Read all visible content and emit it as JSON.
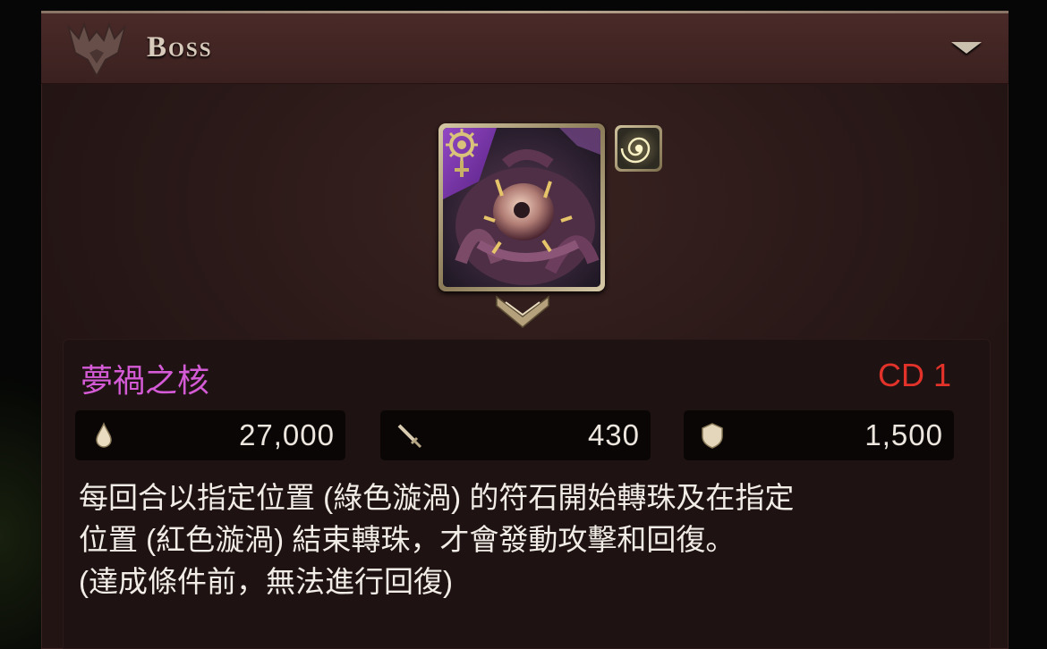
{
  "header": {
    "title": "Boss",
    "emblem_icon": "dragon-head-icon",
    "collapse_icon": "chevron-down-icon"
  },
  "boss": {
    "name": "夢禍之核",
    "cd_label": "CD 1",
    "attribute_icon": "sun-emblem-icon",
    "type_icon": "vortex-icon",
    "name_color": "#d45ad6",
    "cd_color": "#e3322a"
  },
  "stats": {
    "hp": {
      "icon": "hp-drop-icon",
      "value": "27,000"
    },
    "atk": {
      "icon": "sword-icon",
      "value": "430"
    },
    "def": {
      "icon": "shield-icon",
      "value": "1,500"
    }
  },
  "skill": {
    "lines": [
      "每回合以指定位置 (綠色漩渦) 的符石開始轉珠及在指定",
      "位置 (紅色漩渦) 結束轉珠，才會發動攻擊和回復。",
      "(達成條件前，無法進行回復)"
    ]
  }
}
